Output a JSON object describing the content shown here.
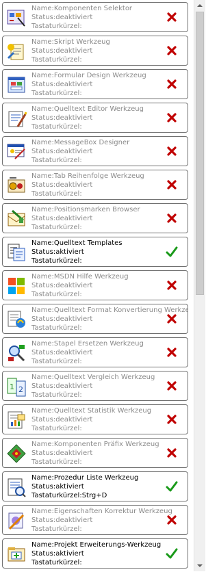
{
  "labels": {
    "name": "Name:",
    "status": "Status:",
    "shortcut": "Tastaturkürzel:"
  },
  "colors": {
    "active_check": "#1a9a1a",
    "inactive_cross": "#c00000",
    "border": "#707070"
  },
  "tools": [
    {
      "name": "Komponenten Selektor",
      "status": "deaktiviert",
      "shortcut": "",
      "enabled": false,
      "icon": "component-selector-icon"
    },
    {
      "name": "Skript Werkzeug",
      "status": "deaktiviert",
      "shortcut": "",
      "enabled": false,
      "icon": "script-tool-icon"
    },
    {
      "name": "Formular Design Werkzeug",
      "status": "deaktiviert",
      "shortcut": "",
      "enabled": false,
      "icon": "form-design-icon"
    },
    {
      "name": "Quelltext Editor Werkzeug",
      "status": "deaktiviert",
      "shortcut": "",
      "enabled": false,
      "icon": "code-editor-icon"
    },
    {
      "name": "MessageBox Designer",
      "status": "deaktiviert",
      "shortcut": "",
      "enabled": false,
      "icon": "messagebox-designer-icon"
    },
    {
      "name": "Tab Reihenfolge Werkzeug",
      "status": "deaktiviert",
      "shortcut": "",
      "enabled": false,
      "icon": "tab-order-icon"
    },
    {
      "name": "Positionsmarken Browser",
      "status": "deaktiviert",
      "shortcut": "",
      "enabled": false,
      "icon": "bookmark-browser-icon"
    },
    {
      "name": "Quelltext Templates",
      "status": "aktiviert",
      "shortcut": "",
      "enabled": true,
      "icon": "code-templates-icon"
    },
    {
      "name": "MSDN Hilfe Werkzeug",
      "status": "deaktiviert",
      "shortcut": "",
      "enabled": false,
      "icon": "msdn-help-icon"
    },
    {
      "name": "Quelltext Format Konvertierung Werkzeug",
      "status": "deaktiviert",
      "shortcut": "",
      "enabled": false,
      "icon": "format-conversion-icon"
    },
    {
      "name": "Stapel Ersetzen Werkzeug",
      "status": "deaktiviert",
      "shortcut": "",
      "enabled": false,
      "icon": "batch-replace-icon"
    },
    {
      "name": "Quelltext Vergleich Werkzeug",
      "status": "deaktiviert",
      "shortcut": "",
      "enabled": false,
      "icon": "code-compare-icon"
    },
    {
      "name": "Quelltext Statistik Werkzeug",
      "status": "deaktiviert",
      "shortcut": "",
      "enabled": false,
      "icon": "code-statistics-icon"
    },
    {
      "name": "Komponenten Präfix Werkzeug",
      "status": "deaktiviert",
      "shortcut": "",
      "enabled": false,
      "icon": "component-prefix-icon"
    },
    {
      "name": "Prozedur Liste Werkzeug",
      "status": "aktiviert",
      "shortcut": "Strg+D",
      "enabled": true,
      "icon": "procedure-list-icon"
    },
    {
      "name": "Eigenschaften Korrektur Werkzeug",
      "status": "deaktiviert",
      "shortcut": "",
      "enabled": false,
      "icon": "property-correction-icon"
    },
    {
      "name": "Projekt Erweiterungs-Werkzeug",
      "status": "aktiviert",
      "shortcut": "",
      "enabled": true,
      "icon": "project-extension-icon"
    }
  ]
}
